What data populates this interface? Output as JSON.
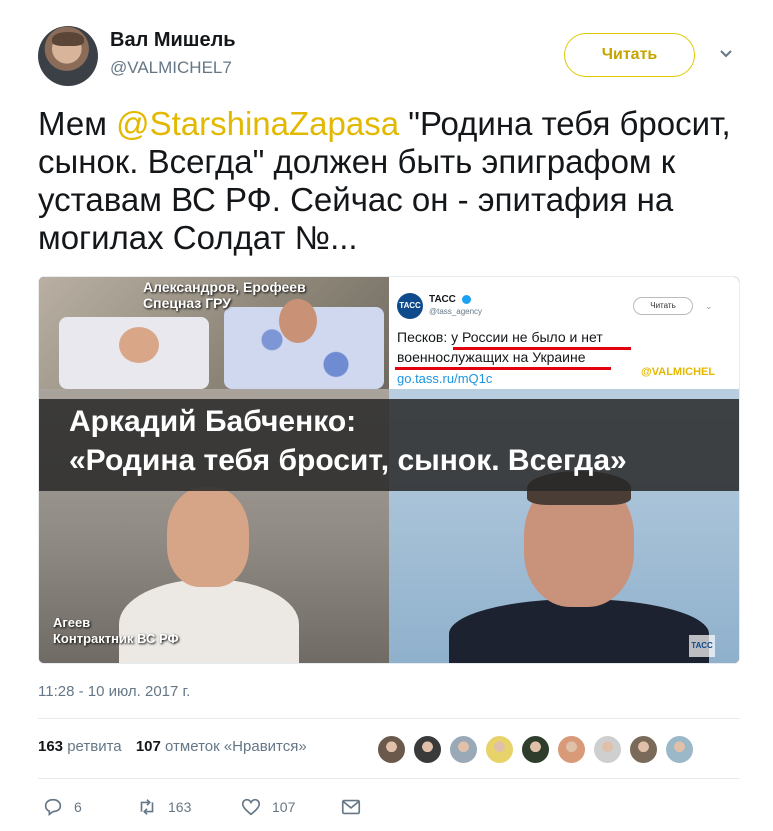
{
  "user": {
    "name": "Вал Мишель",
    "handle": "@VALMICHEL7",
    "follow_label": "Читать"
  },
  "tweet": {
    "text_before": "Мем ",
    "mention": "@StarshinaZapasa",
    "text_after": " \"Родина тебя бросит, сынок. Всегда\" должен быть эпиграфом к уставам ВС РФ. Сейчас он - эпитафия на могилах Солдат №..."
  },
  "media": {
    "caption_top_1": "Александров, Ерофеев",
    "caption_top_2": "Спецназ ГРУ",
    "embedded_tweet": {
      "logo": "ТАСС",
      "name": "ТАСС",
      "handle": "@tass_agency",
      "follow_label": "Читать",
      "line1": "Песков: у России не было и нет",
      "line2": "военнослужащих на Украине",
      "link": "go.tass.ru/mQ1c",
      "watermark": "@VALMICHEL"
    },
    "banner_line1": "Аркадий Бабченко:",
    "banner_line2": "«Родина тебя бросит, сынок. Всегда»",
    "caption_bottom_1": "Агеев",
    "caption_bottom_2": "Контрактник ВС РФ",
    "tass_mark": "ТАСС"
  },
  "timestamp": "11:28 - 10 июл. 2017 г.",
  "stats": {
    "retweets_count": "163",
    "retweets_label": "ретвита",
    "likes_count": "107",
    "likes_label": "отметок «Нравится»"
  },
  "liker_avatar_colors": [
    "#6b5a4c",
    "#3a3a3a",
    "#9aa9b8",
    "#e8d36a",
    "#2f3e2c",
    "#d99a7a",
    "#cfcfcf",
    "#7a6a5a",
    "#9bb8c8"
  ],
  "actions": {
    "reply_count": "6",
    "retweet_count": "163",
    "like_count": "107"
  }
}
